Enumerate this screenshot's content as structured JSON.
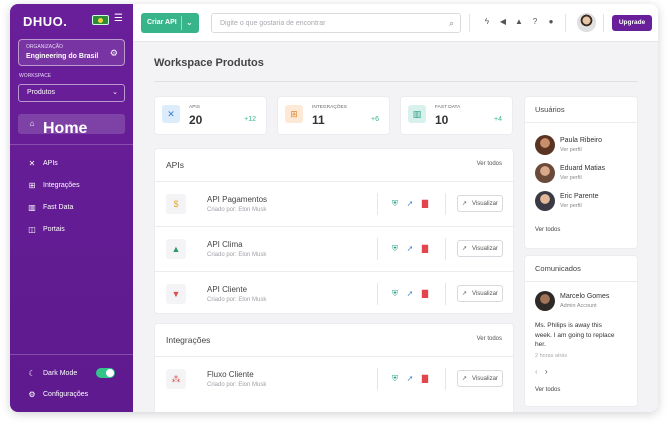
{
  "colors": {
    "brand_purple": "#6a1f9a",
    "accent_green": "#37b489",
    "delete_red": "#e2454b",
    "shield_teal": "#2aa58a"
  },
  "sidebar": {
    "logo": "DHUO.",
    "org_caption": "ORGANIZAÇÃO",
    "org_name": "Engineering do Brasil",
    "workspace_caption": "WORKSPACE",
    "workspace_value": "Produtos",
    "home_label": "Home",
    "items": [
      {
        "label": "APIs",
        "icon": "apis-icon"
      },
      {
        "label": "Integrações",
        "icon": "integrations-icon"
      },
      {
        "label": "Fast Data",
        "icon": "fast-data-icon"
      },
      {
        "label": "Portais",
        "icon": "portals-icon"
      }
    ],
    "dark_mode_label": "Dark Mode",
    "dark_mode_on": true,
    "settings_label": "Configurações"
  },
  "topbar": {
    "create_label": "Criar API",
    "search_placeholder": "Digite o que gostaria de encontrar",
    "upgrade_label": "Upgrade"
  },
  "main": {
    "title": "Workspace Produtos",
    "stats": [
      {
        "label": "APIS",
        "value": "20",
        "delta": "+12",
        "icon": "apis-icon"
      },
      {
        "label": "INTEGRAÇÕES",
        "value": "11",
        "delta": "+6",
        "icon": "integrations-icon"
      },
      {
        "label": "FAST DATA",
        "value": "10",
        "delta": "+4",
        "icon": "fast-data-icon"
      }
    ],
    "apis_panel": {
      "title": "APIs",
      "link": "Ver todos",
      "rows": [
        {
          "name": "API Pagamentos",
          "sub": "Criado por: Elon Musk",
          "thumb": "payments-thumb-icon"
        },
        {
          "name": "API Clima",
          "sub": "Criado por: Elon Musk",
          "thumb": "climate-thumb-icon"
        },
        {
          "name": "API Cliente",
          "sub": "Criado por: Elon Musk",
          "thumb": "client-thumb-icon"
        }
      ],
      "view_label": "Visualizar"
    },
    "integrations_panel": {
      "title": "Integrações",
      "link": "Ver todos",
      "rows": [
        {
          "name": "Fluxo Cliente",
          "sub": "Criado por: Elon Musk",
          "thumb": "flow-thumb-icon"
        }
      ],
      "view_label": "Visualizar"
    }
  },
  "users_panel": {
    "title": "Usuários",
    "users": [
      {
        "name": "Paula Ribeiro",
        "role": "Ver perfil"
      },
      {
        "name": "Eduard Matias",
        "role": "Ver perfil"
      },
      {
        "name": "Eric Parente",
        "role": "Ver perfil"
      }
    ],
    "link": "Ver todos"
  },
  "news_panel": {
    "title": "Comunicados",
    "author": "Marcelo Gomes",
    "author_role": "Admin Account",
    "message": "Ms. Philips is away this week. I am going to replace her.",
    "time": "2 horas atrás",
    "link": "Ver todos"
  }
}
